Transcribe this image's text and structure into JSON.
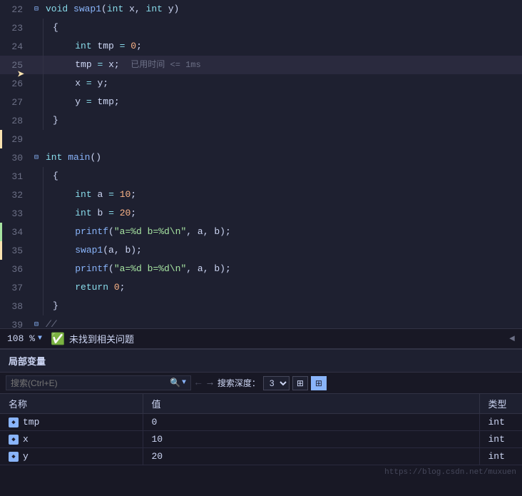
{
  "editor": {
    "lines": [
      {
        "num": 22,
        "indent": 0,
        "hasFold": true,
        "foldType": "minus",
        "content": "void swap1(int x, int y)",
        "type": "function-def",
        "gutter": "none"
      },
      {
        "num": 23,
        "indent": 1,
        "hasFold": false,
        "content": "{",
        "type": "brace",
        "gutter": "none"
      },
      {
        "num": 24,
        "indent": 2,
        "hasFold": false,
        "content": "    int tmp = 0;",
        "type": "code",
        "gutter": "none"
      },
      {
        "num": 25,
        "indent": 2,
        "hasFold": false,
        "content": "    tmp = x;",
        "type": "code-hint",
        "hint": "  已用时间 <= 1ms",
        "gutter": "current",
        "isDebug": true
      },
      {
        "num": 26,
        "indent": 2,
        "hasFold": false,
        "content": "    x = y;",
        "type": "code",
        "gutter": "none"
      },
      {
        "num": 27,
        "indent": 2,
        "hasFold": false,
        "content": "    y = tmp;",
        "type": "code",
        "gutter": "none"
      },
      {
        "num": 28,
        "indent": 1,
        "hasFold": false,
        "content": "}",
        "type": "brace",
        "gutter": "none"
      },
      {
        "num": 29,
        "indent": 0,
        "hasFold": false,
        "content": "",
        "type": "empty",
        "gutter": "yellow"
      },
      {
        "num": 30,
        "indent": 0,
        "hasFold": true,
        "foldType": "minus",
        "content": "int main()",
        "type": "function-def",
        "gutter": "none"
      },
      {
        "num": 31,
        "indent": 1,
        "hasFold": false,
        "content": "{",
        "type": "brace",
        "gutter": "none"
      },
      {
        "num": 32,
        "indent": 2,
        "hasFold": false,
        "content": "    int a = 10;",
        "type": "code",
        "gutter": "none"
      },
      {
        "num": 33,
        "indent": 2,
        "hasFold": false,
        "content": "    int b = 20;",
        "type": "code",
        "gutter": "none"
      },
      {
        "num": 34,
        "indent": 2,
        "hasFold": false,
        "content": "    printf(\"a=%d b=%d\\n\", a, b);",
        "type": "code",
        "gutter": "green"
      },
      {
        "num": 35,
        "indent": 2,
        "hasFold": false,
        "content": "    swap1(a, b);",
        "type": "code",
        "gutter": "yellow"
      },
      {
        "num": 36,
        "indent": 2,
        "hasFold": false,
        "content": "    printf(\"a=%d b=%d\\n\", a, b);",
        "type": "code",
        "gutter": "none"
      },
      {
        "num": 37,
        "indent": 2,
        "hasFold": false,
        "content": "    return 0;",
        "type": "code",
        "gutter": "none"
      },
      {
        "num": 38,
        "indent": 1,
        "hasFold": false,
        "content": "}",
        "type": "brace",
        "gutter": "none"
      },
      {
        "num": 39,
        "indent": 0,
        "hasFold": true,
        "foldType": "minus",
        "content": "//",
        "type": "comment",
        "gutter": "none"
      }
    ]
  },
  "statusbar": {
    "zoom": "108 %",
    "check_text": "未找到相关问题",
    "arrow": "◄"
  },
  "vars_panel": {
    "title": "局部变量",
    "search_placeholder": "搜索(Ctrl+E)",
    "search_icon": "🔍",
    "nav_back": "←",
    "nav_forward": "→",
    "depth_label": "搜索深度：",
    "depth_value": "3",
    "columns": [
      "名称",
      "值",
      "类型"
    ],
    "rows": [
      {
        "name": "tmp",
        "value": "0",
        "type": "int",
        "valueClass": "var-value-0"
      },
      {
        "name": "x",
        "value": "10",
        "type": "int",
        "valueClass": "var-value"
      },
      {
        "name": "y",
        "value": "20",
        "type": "int",
        "valueClass": "var-value"
      }
    ],
    "watermark": "https://blog.csdn.net/muxuen"
  }
}
